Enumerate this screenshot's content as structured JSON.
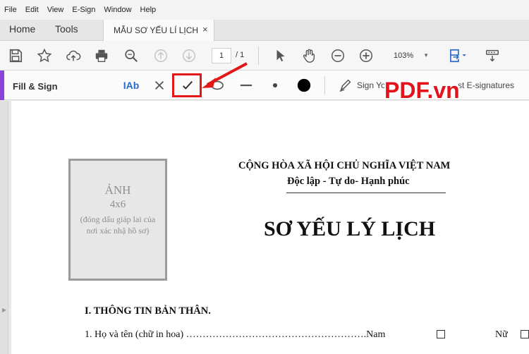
{
  "menu": [
    "File",
    "Edit",
    "View",
    "E-Sign",
    "Window",
    "Help"
  ],
  "tabs": {
    "home": "Home",
    "tools": "Tools",
    "document": "MẪU SƠ YẾU LÍ LỊCH",
    "close": "×"
  },
  "toolbar": {
    "page_current": "1",
    "page_total": "/ 1",
    "zoom": "103%"
  },
  "fill_sign": {
    "title": "Fill & Sign",
    "text_tool": "IAb",
    "sign_label": "Sign Yo",
    "request_label": "st E-signatures"
  },
  "watermark": "PDF.vn",
  "colors": {
    "accent": "#8a44d9",
    "highlight": "#e11818",
    "watermark": "#e3121b"
  },
  "document": {
    "photo": {
      "line1": "ẢNH",
      "line2": "4x6",
      "line3": "(đóng dấu giáp lai của nơi xác nhậ hồ sơ)"
    },
    "nation": "CỘNG HÒA XÃ HỘI CHỦ NGHĨA VIỆT NAM",
    "motto": "Độc lập - Tự do- Hạnh phúc",
    "title": "SƠ YẾU LÝ LỊCH",
    "section1": "I. THÔNG TIN BẢN THÂN.",
    "line1": "1. Họ và tên (chữ in hoa) ……………………………………………….Nam",
    "female": "Nữ"
  }
}
